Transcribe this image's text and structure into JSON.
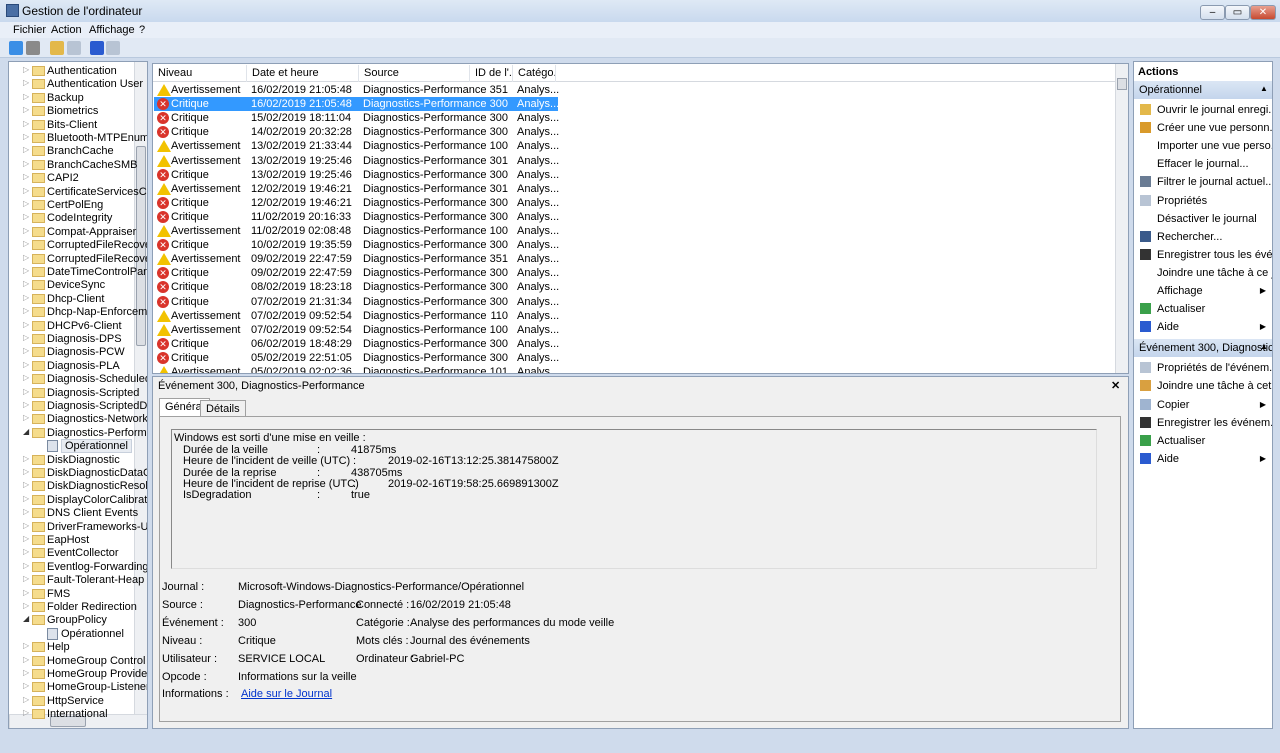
{
  "window": {
    "title": "Gestion de l'ordinateur",
    "minimize": "–",
    "maximize": "▭",
    "close": "✕"
  },
  "menu": [
    "Fichier",
    "Action",
    "Affichage",
    "?"
  ],
  "toolbar": [
    {
      "icon": "back-arrow-icon",
      "color": "#3a8ee6"
    },
    {
      "icon": "forward-arrow-icon",
      "color": "#8a8a8a"
    },
    {
      "icon": "up-folder-icon",
      "color": "#e3b84a"
    },
    {
      "icon": "show-hide-tree-icon",
      "color": "#b8c4d4"
    },
    {
      "icon": "help-icon",
      "color": "#2a5bd0"
    },
    {
      "icon": "show-hide-actions-icon",
      "color": "#b8c4d4"
    }
  ],
  "tree": [
    {
      "label": "Authentication"
    },
    {
      "label": "Authentication User Ir"
    },
    {
      "label": "Backup"
    },
    {
      "label": "Biometrics"
    },
    {
      "label": "Bits-Client"
    },
    {
      "label": "Bluetooth-MTPEnum"
    },
    {
      "label": "BranchCache"
    },
    {
      "label": "BranchCacheSMB"
    },
    {
      "label": "CAPI2"
    },
    {
      "label": "CertificateServicesClie"
    },
    {
      "label": "CertPolEng"
    },
    {
      "label": "CodeIntegrity"
    },
    {
      "label": "Compat-Appraiser"
    },
    {
      "label": "CorruptedFileRecovery"
    },
    {
      "label": "CorruptedFileRecovery"
    },
    {
      "label": "DateTimeControlPane"
    },
    {
      "label": "DeviceSync"
    },
    {
      "label": "Dhcp-Client"
    },
    {
      "label": "Dhcp-Nap-Enforceme"
    },
    {
      "label": "DHCPv6-Client"
    },
    {
      "label": "Diagnosis-DPS"
    },
    {
      "label": "Diagnosis-PCW"
    },
    {
      "label": "Diagnosis-PLA"
    },
    {
      "label": "Diagnosis-Scheduled"
    },
    {
      "label": "Diagnosis-Scripted"
    },
    {
      "label": "Diagnosis-ScriptedDia"
    },
    {
      "label": "Diagnostics-Networkin"
    },
    {
      "label": "Diagnostics-Performa",
      "expanded": true
    },
    {
      "label": "Opérationnel",
      "child": true,
      "selected": true
    },
    {
      "label": "DiskDiagnostic"
    },
    {
      "label": "DiskDiagnosticDataCo"
    },
    {
      "label": "DiskDiagnosticResolve"
    },
    {
      "label": "DisplayColorCalibratic"
    },
    {
      "label": "DNS Client Events"
    },
    {
      "label": "DriverFrameworks-Use"
    },
    {
      "label": "EapHost"
    },
    {
      "label": "EventCollector"
    },
    {
      "label": "Eventlog-ForwardingF"
    },
    {
      "label": "Fault-Tolerant-Heap"
    },
    {
      "label": "FMS"
    },
    {
      "label": "Folder Redirection"
    },
    {
      "label": "GroupPolicy",
      "expanded": true
    },
    {
      "label": "Opérationnel",
      "child": true
    },
    {
      "label": "Help"
    },
    {
      "label": "HomeGroup Control F"
    },
    {
      "label": "HomeGroup Provider"
    },
    {
      "label": "HomeGroup-ListenerS"
    },
    {
      "label": "HttpService"
    },
    {
      "label": "International"
    }
  ],
  "events": {
    "columns": [
      "Niveau",
      "Date et heure",
      "Source",
      "ID de l'...",
      "Catégo..."
    ],
    "rows": [
      {
        "level": "Avertissement",
        "type": "warn",
        "date": "16/02/2019 21:05:48",
        "source": "Diagnostics-Performance",
        "id": "351",
        "cat": "Analys..."
      },
      {
        "level": "Critique",
        "type": "crit",
        "date": "16/02/2019 21:05:48",
        "source": "Diagnostics-Performance",
        "id": "300",
        "cat": "Analys...",
        "selected": true
      },
      {
        "level": "Critique",
        "type": "crit",
        "date": "15/02/2019 18:11:04",
        "source": "Diagnostics-Performance",
        "id": "300",
        "cat": "Analys..."
      },
      {
        "level": "Critique",
        "type": "crit",
        "date": "14/02/2019 20:32:28",
        "source": "Diagnostics-Performance",
        "id": "300",
        "cat": "Analys..."
      },
      {
        "level": "Avertissement",
        "type": "warn",
        "date": "13/02/2019 21:33:44",
        "source": "Diagnostics-Performance",
        "id": "100",
        "cat": "Analys..."
      },
      {
        "level": "Avertissement",
        "type": "warn",
        "date": "13/02/2019 19:25:46",
        "source": "Diagnostics-Performance",
        "id": "301",
        "cat": "Analys..."
      },
      {
        "level": "Critique",
        "type": "crit",
        "date": "13/02/2019 19:25:46",
        "source": "Diagnostics-Performance",
        "id": "300",
        "cat": "Analys..."
      },
      {
        "level": "Avertissement",
        "type": "warn",
        "date": "12/02/2019 19:46:21",
        "source": "Diagnostics-Performance",
        "id": "301",
        "cat": "Analys..."
      },
      {
        "level": "Critique",
        "type": "crit",
        "date": "12/02/2019 19:46:21",
        "source": "Diagnostics-Performance",
        "id": "300",
        "cat": "Analys..."
      },
      {
        "level": "Critique",
        "type": "crit",
        "date": "11/02/2019 20:16:33",
        "source": "Diagnostics-Performance",
        "id": "300",
        "cat": "Analys..."
      },
      {
        "level": "Avertissement",
        "type": "warn",
        "date": "11/02/2019 02:08:48",
        "source": "Diagnostics-Performance",
        "id": "100",
        "cat": "Analys..."
      },
      {
        "level": "Critique",
        "type": "crit",
        "date": "10/02/2019 19:35:59",
        "source": "Diagnostics-Performance",
        "id": "300",
        "cat": "Analys..."
      },
      {
        "level": "Avertissement",
        "type": "warn",
        "date": "09/02/2019 22:47:59",
        "source": "Diagnostics-Performance",
        "id": "351",
        "cat": "Analys..."
      },
      {
        "level": "Critique",
        "type": "crit",
        "date": "09/02/2019 22:47:59",
        "source": "Diagnostics-Performance",
        "id": "300",
        "cat": "Analys..."
      },
      {
        "level": "Critique",
        "type": "crit",
        "date": "08/02/2019 18:23:18",
        "source": "Diagnostics-Performance",
        "id": "300",
        "cat": "Analys..."
      },
      {
        "level": "Critique",
        "type": "crit",
        "date": "07/02/2019 21:31:34",
        "source": "Diagnostics-Performance",
        "id": "300",
        "cat": "Analys..."
      },
      {
        "level": "Avertissement",
        "type": "warn",
        "date": "07/02/2019 09:52:54",
        "source": "Diagnostics-Performance",
        "id": "110",
        "cat": "Analys..."
      },
      {
        "level": "Avertissement",
        "type": "warn",
        "date": "07/02/2019 09:52:54",
        "source": "Diagnostics-Performance",
        "id": "100",
        "cat": "Analys..."
      },
      {
        "level": "Critique",
        "type": "crit",
        "date": "06/02/2019 18:48:29",
        "source": "Diagnostics-Performance",
        "id": "300",
        "cat": "Analys..."
      },
      {
        "level": "Critique",
        "type": "crit",
        "date": "05/02/2019 22:51:05",
        "source": "Diagnostics-Performance",
        "id": "300",
        "cat": "Analys..."
      },
      {
        "level": "Avertissement",
        "type": "warn",
        "date": "05/02/2019 02:02:36",
        "source": "Diagnostics-Performance",
        "id": "101",
        "cat": "Analys..."
      }
    ]
  },
  "detail": {
    "title": "Événement 300, Diagnostics-Performance",
    "close": "✕",
    "tabs": [
      "Général",
      "Détails"
    ],
    "description": {
      "heading": "Windows est sorti d'une mise en veille :",
      "lines": [
        {
          "k": "Durée de la veille",
          "v": "41875ms",
          "far": false
        },
        {
          "k": "Heure de l'incident de veille (UTC)",
          "v": "2019-02-16T13:12:25.381475800Z",
          "far": true
        },
        {
          "k": "Durée de la reprise",
          "v": "438705ms",
          "far": false
        },
        {
          "k": "Heure de l'incident de reprise (UTC)",
          "v": "2019-02-16T19:58:25.669891300Z",
          "far": true
        },
        {
          "k": "IsDegradation",
          "v": "true",
          "far": false
        }
      ]
    },
    "fields": {
      "journal_label": "Journal :",
      "journal": "Microsoft-Windows-Diagnostics-Performance/Opérationnel",
      "source_label": "Source :",
      "source": "Diagnostics-Performance",
      "connecte_label": "Connecté :",
      "connecte": "16/02/2019 21:05:48",
      "evenement_label": "Événement :",
      "evenement": "300",
      "categorie_label": "Catégorie :",
      "categorie": "Analyse des performances du mode veille",
      "niveau_label": "Niveau :",
      "niveau": "Critique",
      "motscles_label": "Mots clés :",
      "motscles": "Journal des événements",
      "utilisateur_label": "Utilisateur :",
      "utilisateur": "SERVICE LOCAL",
      "ordinateur_label": "Ordinateur :",
      "ordinateur": "Gabriel-PC",
      "opcode_label": "Opcode :",
      "opcode": "Informations sur la veille",
      "informations_label": "Informations :",
      "informations_link": "Aide sur le Journal"
    }
  },
  "actions": {
    "title": "Actions",
    "sections": [
      {
        "header": "Opérationnel",
        "items": [
          {
            "label": "Ouvrir le journal enregi...",
            "icon": "open-folder-icon",
            "color": "#e3b84a"
          },
          {
            "label": "Créer une vue personn...",
            "icon": "filter-star-icon",
            "color": "#d99a2a"
          },
          {
            "label": "Importer une vue perso...",
            "icon": ""
          },
          {
            "label": "Effacer le journal...",
            "icon": ""
          },
          {
            "label": "Filtrer le journal actuel...",
            "icon": "filter-icon",
            "color": "#6a7c94"
          },
          {
            "label": "Propriétés",
            "icon": "properties-icon",
            "color": "#b8c4d4"
          },
          {
            "label": "Désactiver le journal",
            "icon": ""
          },
          {
            "label": "Rechercher...",
            "icon": "binoculars-icon",
            "color": "#3a5a8a"
          },
          {
            "label": "Enregistrer tous les évé...",
            "icon": "save-icon",
            "color": "#333333"
          },
          {
            "label": "Joindre une tâche à ce j...",
            "icon": ""
          },
          {
            "label": "Affichage",
            "icon": "",
            "submenu": true
          },
          {
            "label": "Actualiser",
            "icon": "refresh-icon",
            "color": "#3aa04a"
          },
          {
            "label": "Aide",
            "icon": "help-icon",
            "color": "#2a5bd0",
            "submenu": true
          }
        ]
      },
      {
        "header": "Événement 300, Diagnostics...",
        "items": [
          {
            "label": "Propriétés de l'événem...",
            "icon": "event-properties-icon",
            "color": "#b8c4d4"
          },
          {
            "label": "Joindre une tâche à cet...",
            "icon": "attach-task-icon",
            "color": "#d9a040"
          },
          {
            "label": "Copier",
            "icon": "copy-icon",
            "color": "#9fb4d0",
            "submenu": true
          },
          {
            "label": "Enregistrer les événem...",
            "icon": "save-icon",
            "color": "#333333"
          },
          {
            "label": "Actualiser",
            "icon": "refresh-icon",
            "color": "#3aa04a"
          },
          {
            "label": "Aide",
            "icon": "help-icon",
            "color": "#2a5bd0",
            "submenu": true
          }
        ]
      }
    ]
  }
}
